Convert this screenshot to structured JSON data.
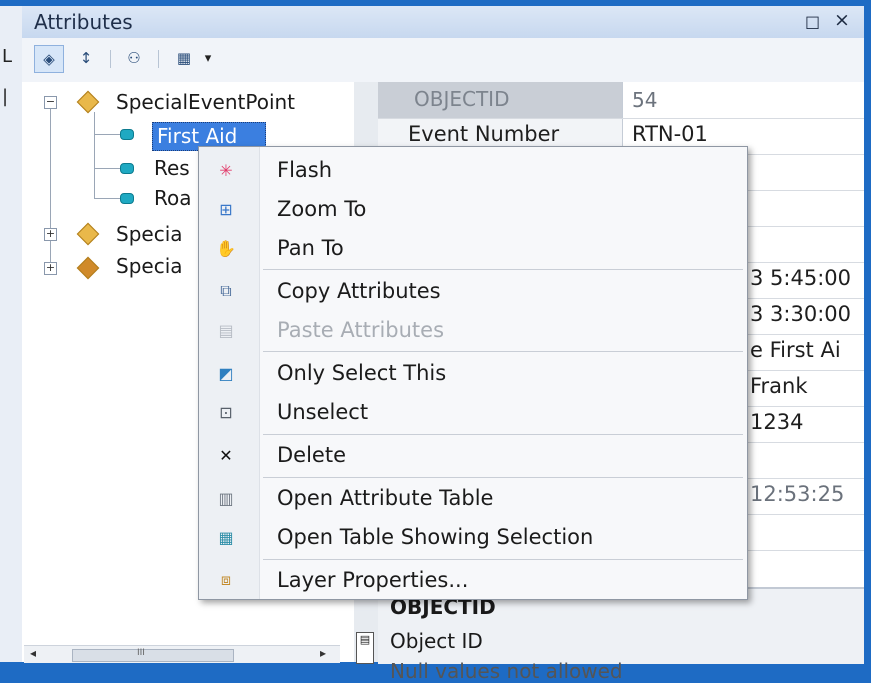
{
  "window": {
    "title": "Attributes",
    "restore_glyph": "□",
    "close_glyph": "×"
  },
  "left_edge": {
    "glyphs": [
      "L",
      "|"
    ]
  },
  "toolbar": {
    "items": [
      {
        "name": "list-by-layer-icon",
        "glyph": "◈",
        "selected": true
      },
      {
        "name": "sort-icon",
        "glyph": "↕"
      },
      {
        "name": "related-tables-icon",
        "glyph": "⚇"
      },
      {
        "name": "options-icon",
        "glyph": "▦",
        "dropdown": "▾"
      }
    ]
  },
  "tree": {
    "root_label": "SpecialEventPoint",
    "children": [
      "First Aid",
      "Res",
      "Roa"
    ],
    "siblings": [
      "Specia",
      "Specia"
    ],
    "scroll_left": "◂",
    "scroll_thumb": "III",
    "scroll_right": "▸"
  },
  "table": {
    "rows": [
      {
        "key": "OBJECTID",
        "value": "54"
      },
      {
        "key": "Event Number",
        "value": "RTN-01"
      },
      {
        "key": "",
        "value": ""
      },
      {
        "key": "",
        "value": ""
      },
      {
        "key": "",
        "value": ""
      },
      {
        "key": "",
        "value": "3 5:45:00"
      },
      {
        "key": "",
        "value": "3 3:30:00"
      },
      {
        "key": "",
        "value": "e First Ai"
      },
      {
        "key": "",
        "value": " Frank"
      },
      {
        "key": "",
        "value": "1234"
      },
      {
        "key": "",
        "value": ""
      },
      {
        "key": "",
        "value": " 12:53:25"
      },
      {
        "key": "",
        "value": ""
      }
    ]
  },
  "description": {
    "title": "OBJECTID",
    "text": "Object ID",
    "text2": "Null values not allowed"
  },
  "context_menu": {
    "items": [
      {
        "label": "Flash",
        "icon": "flash-icon",
        "glyph": "✳",
        "color": "#e23b6a"
      },
      {
        "label": "Zoom To",
        "icon": "zoom-to-icon",
        "glyph": "⊞",
        "color": "#3a78c9"
      },
      {
        "label": "Pan To",
        "icon": "pan-to-icon",
        "glyph": "✋",
        "color": "#3a78c9"
      },
      {
        "label": "Copy Attributes",
        "icon": "copy-attributes-icon",
        "glyph": "⧉",
        "color": "#4d6f9c"
      },
      {
        "label": "Paste Attributes",
        "icon": "paste-attributes-icon",
        "glyph": "▤",
        "color": "#b7bcc4",
        "disabled": true
      },
      {
        "label": "Only Select This",
        "icon": "only-select-icon",
        "glyph": "◩",
        "color": "#2f7fbf"
      },
      {
        "label": "Unselect",
        "icon": "unselect-icon",
        "glyph": "⊡",
        "color": "#58606a"
      },
      {
        "label": "Delete",
        "icon": "delete-icon",
        "glyph": "✕",
        "color": "#111111"
      },
      {
        "label": "Open Attribute Table",
        "icon": "attribute-table-icon",
        "glyph": "▥",
        "color": "#6f7782"
      },
      {
        "label": "Open Table Showing Selection",
        "icon": "selection-table-icon",
        "glyph": "▦",
        "color": "#2f8fa8"
      },
      {
        "label": "Layer Properties...",
        "icon": "layer-properties-icon",
        "glyph": "⧈",
        "color": "#c48c2e"
      }
    ]
  }
}
